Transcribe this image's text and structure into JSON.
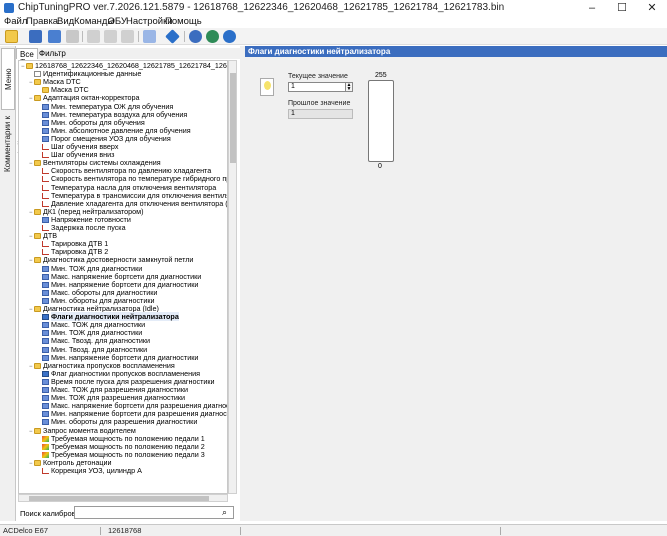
{
  "window": {
    "title": "ChipTuningPRO ver.7.2026.121.5879 - 12618768_12622346_12620468_12621785_12621784_12621783.bin",
    "controls": [
      "–",
      "☐",
      "✕"
    ]
  },
  "menu": [
    "Файл",
    "Правка",
    "Вид",
    "Команды",
    "ЭБУ",
    "Настройки",
    "Помощь"
  ],
  "toolbar": {
    "buttons": [
      "open-folder-icon",
      "save-icon",
      "save-as-icon",
      "edit-icon",
      "copy-icon",
      "paste-icon",
      "undo-icon",
      "tools-icon",
      "nav-diamond-icon",
      "search-settings-icon",
      "checksum-icon",
      "help-icon"
    ]
  },
  "side_tabs": [
    "Меню калибровок",
    "Комментарии к файлу"
  ],
  "left_tabs": [
    "Все",
    "Фильтр"
  ],
  "tree": [
    {
      "level": 0,
      "icon": "folder",
      "label": "12618768_12622346_12620468_12621785_12621784_12621783.bin",
      "expanded": true
    },
    {
      "level": 1,
      "icon": "doc",
      "label": "Идентификационные данные"
    },
    {
      "level": 1,
      "icon": "folder",
      "label": "Маска DTC",
      "expanded": true
    },
    {
      "level": 2,
      "icon": "folder",
      "label": "Маска DTC"
    },
    {
      "level": 1,
      "icon": "folder",
      "label": "Адаптация октан-корректора",
      "expanded": true
    },
    {
      "level": 2,
      "icon": "tbl",
      "label": "Мин. температура ОЖ для обучения"
    },
    {
      "level": 2,
      "icon": "tbl",
      "label": "Мин. температура воздуха для обучения"
    },
    {
      "level": 2,
      "icon": "tbl",
      "label": "Мин. обороты для обучения"
    },
    {
      "level": 2,
      "icon": "tbl",
      "label": "Мин. абсолютное давление для обучения"
    },
    {
      "level": 2,
      "icon": "tbl",
      "label": "Порог смещения УОЗ для обучения"
    },
    {
      "level": 2,
      "icon": "curve",
      "label": "Шаг обучения вверх"
    },
    {
      "level": 2,
      "icon": "curve",
      "label": "Шаг обучения вниз"
    },
    {
      "level": 1,
      "icon": "folder",
      "label": "Вентиляторы системы охлаждения",
      "expanded": true
    },
    {
      "level": 2,
      "icon": "curve",
      "label": "Скорость вентилятора по давлению хладагента"
    },
    {
      "level": 2,
      "icon": "curve",
      "label": "Скорость вентилятора по температуре гибридного при"
    },
    {
      "level": 2,
      "icon": "curve",
      "label": "Температура насла для отключения вентилятора"
    },
    {
      "level": 2,
      "icon": "curve",
      "label": "Температура в трансмиссии для отключения вентилято"
    },
    {
      "level": 2,
      "icon": "curve",
      "label": "Давление хладагента для отключения вентилятора (ко"
    },
    {
      "level": 1,
      "icon": "folder",
      "label": "ДК1 (перед нейтрализатором)",
      "expanded": true
    },
    {
      "level": 2,
      "icon": "tbl",
      "label": "Напряжение готовности"
    },
    {
      "level": 2,
      "icon": "curve",
      "label": "Задержка после пуска"
    },
    {
      "level": 1,
      "icon": "folder",
      "label": "ДТВ",
      "expanded": true
    },
    {
      "level": 2,
      "icon": "curve",
      "label": "Тарировка ДТВ 1"
    },
    {
      "level": 2,
      "icon": "curve",
      "label": "Тарировка ДТВ 2"
    },
    {
      "level": 1,
      "icon": "folder",
      "label": "Диагностика достоверности замкнутой петли",
      "expanded": true
    },
    {
      "level": 2,
      "icon": "tbl",
      "label": "Мин. ТОЖ для диагностики"
    },
    {
      "level": 2,
      "icon": "tbl",
      "label": "Макс. напряжение бортсети для диагностики"
    },
    {
      "level": 2,
      "icon": "tbl",
      "label": "Мин. напряжение бортсети для диагностики"
    },
    {
      "level": 2,
      "icon": "tbl",
      "label": "Макс. обороты для диагностики"
    },
    {
      "level": 2,
      "icon": "tbl",
      "label": "Мин. обороты для диагностики"
    },
    {
      "level": 1,
      "icon": "folder",
      "label": "Диагностика нейтрализатора (Idle)",
      "expanded": true
    },
    {
      "level": 2,
      "icon": "flag",
      "label": "Флаги диагностики нейтрализатора",
      "selected": true
    },
    {
      "level": 2,
      "icon": "tbl",
      "label": "Макс. ТОЖ для диагностики"
    },
    {
      "level": 2,
      "icon": "tbl",
      "label": "Мин. ТОЖ для диагностики"
    },
    {
      "level": 2,
      "icon": "tbl",
      "label": "Макс. Твозд. для диагностики"
    },
    {
      "level": 2,
      "icon": "tbl",
      "label": "Мин. Твозд. для диагностики"
    },
    {
      "level": 2,
      "icon": "tbl",
      "label": "Мин. напряжение бортсети для диагностики"
    },
    {
      "level": 1,
      "icon": "folder",
      "label": "Диагностика пропусков воспламенения",
      "expanded": true
    },
    {
      "level": 2,
      "icon": "flag",
      "label": "Флаг диагностики пропусков воспламенения"
    },
    {
      "level": 2,
      "icon": "tbl",
      "label": "Время после пуска для разрешения диагностики"
    },
    {
      "level": 2,
      "icon": "tbl",
      "label": "Макс. ТОЖ для разрешения диагностики"
    },
    {
      "level": 2,
      "icon": "tbl",
      "label": "Мин. ТОЖ для разрешения диагностики"
    },
    {
      "level": 2,
      "icon": "tbl",
      "label": "Макс. напряжение бортсети для разрешения диагност"
    },
    {
      "level": 2,
      "icon": "tbl",
      "label": "Мин. напряжение бортсети для разрешения диагности"
    },
    {
      "level": 2,
      "icon": "tbl",
      "label": "Мин. обороты для разрешения диагностики"
    },
    {
      "level": 1,
      "icon": "folder",
      "label": "Запрос момента водителем",
      "expanded": true
    },
    {
      "level": 2,
      "icon": "map3d",
      "label": "Требуемая мощность по положению педали 1"
    },
    {
      "level": 2,
      "icon": "map3d",
      "label": "Требуемая мощность по положению педали 2"
    },
    {
      "level": 2,
      "icon": "map3d",
      "label": "Требуемая мощность по положению педали 3"
    },
    {
      "level": 1,
      "icon": "folder",
      "label": "Контроль детонации",
      "expanded": true
    },
    {
      "level": 2,
      "icon": "curve",
      "label": "Коррекция УОЗ, цилиндр А"
    }
  ],
  "search": {
    "label": "Поиск калибровки",
    "value": ""
  },
  "panel": {
    "title": "Флаги диагностики нейтрализатора",
    "current_label": "Текущее значение",
    "current_value": "1",
    "previous_label": "Прошлое значение",
    "previous_value": "1",
    "gauge_max": "255",
    "gauge_min": "0",
    "gauge_fraction": 0.0
  },
  "status": [
    "ACDelco E67",
    "12618768",
    "",
    ""
  ],
  "colors": {
    "accent": "#3b6dbf",
    "folder": "#f2c94c"
  }
}
